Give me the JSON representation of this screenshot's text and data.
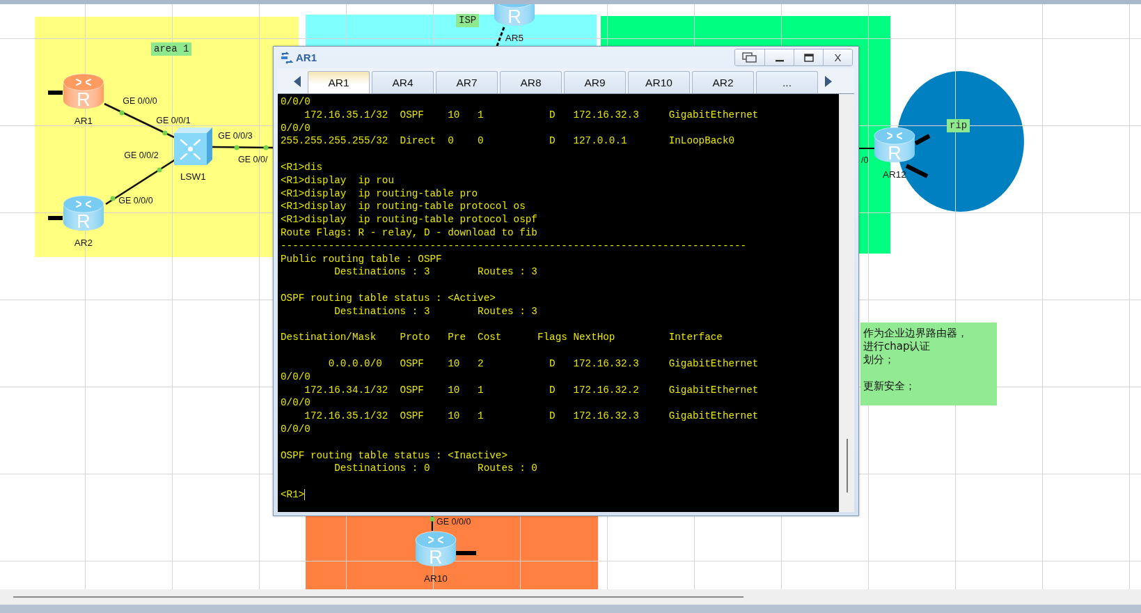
{
  "topology": {
    "areas": [
      {
        "kind": "rect",
        "color": "#ffff80",
        "label": "area 1"
      },
      {
        "kind": "rect",
        "color": "#80ffff",
        "label": "ISP"
      },
      {
        "kind": "rect",
        "color": "#00ff80"
      },
      {
        "kind": "rect",
        "color": "#ff8040"
      },
      {
        "kind": "ellipse",
        "color": "#0080c0",
        "label": "rip"
      }
    ],
    "devices": [
      {
        "kind": "router",
        "name": "AR1",
        "glyph": "R",
        "color": "#ff9a60"
      },
      {
        "kind": "router",
        "name": "AR2",
        "glyph": "R",
        "color": "#78ccf2"
      },
      {
        "kind": "switch",
        "name": "LSW1",
        "color": "#88d8fa"
      },
      {
        "kind": "router",
        "name": "AR5",
        "glyph": "R",
        "color": "#78ccf2"
      },
      {
        "kind": "router",
        "name": "AR12",
        "glyph": "R",
        "color": "#78ccf2"
      },
      {
        "kind": "router",
        "name": "AR10",
        "glyph": "R",
        "color": "#78ccf2"
      }
    ],
    "port_labels": [
      "GE 0/0/0",
      "GE 0/0/1",
      "GE 0/0/3",
      "GE 0/0/2",
      "GE 0/0/0",
      "GE 0/0/",
      "/0",
      "GE 0/0/0"
    ],
    "note": {
      "paragraphs": [
        [
          "作为企业边界路由器，",
          "进行chap认证",
          "划分；"
        ],
        [
          "更新安全；"
        ]
      ]
    }
  },
  "console": {
    "title": "AR1",
    "close": "X",
    "tabs": [
      {
        "label": "AR1",
        "selected": true
      },
      {
        "label": "AR4",
        "selected": false
      },
      {
        "label": "AR7",
        "selected": false
      },
      {
        "label": "AR8",
        "selected": false
      },
      {
        "label": "AR9",
        "selected": false
      },
      {
        "label": "AR10",
        "selected": false
      },
      {
        "label": "AR2",
        "selected": false
      },
      {
        "label": "...",
        "selected": false
      }
    ],
    "output": [
      [
        "0/0/0",
        "    172.16.35.1/32  OSPF    10   1           D   172.16.32.3     GigabitEthernet",
        "0/0/0",
        "255.255.255.255/32  Direct  0    0           D   127.0.0.1       InLoopBack0"
      ],
      [
        "<R1>dis",
        "<R1>display  ip rou",
        "<R1>display  ip routing-table pro",
        "<R1>display  ip routing-table protocol os",
        "<R1>display  ip routing-table protocol ospf",
        "Route Flags: R - relay, D - download to fib",
        "------------------------------------------------------------------------------",
        "Public routing table : OSPF",
        "         Destinations : 3        Routes : 3"
      ],
      [
        "OSPF routing table status : <Active>",
        "         Destinations : 3        Routes : 3"
      ],
      [
        "Destination/Mask    Proto   Pre  Cost      Flags NextHop         Interface"
      ],
      [
        "        0.0.0.0/0   OSPF    10   2           D   172.16.32.3     GigabitEthernet",
        "0/0/0",
        "    172.16.34.1/32  OSPF    10   1           D   172.16.32.2     GigabitEthernet",
        "0/0/0",
        "    172.16.35.1/32  OSPF    10   1           D   172.16.32.3     GigabitEthernet",
        "0/0/0"
      ],
      [
        "OSPF routing table status : <Inactive>",
        "         Destinations : 0        Routes : 0"
      ],
      [
        "<R1>"
      ]
    ]
  }
}
